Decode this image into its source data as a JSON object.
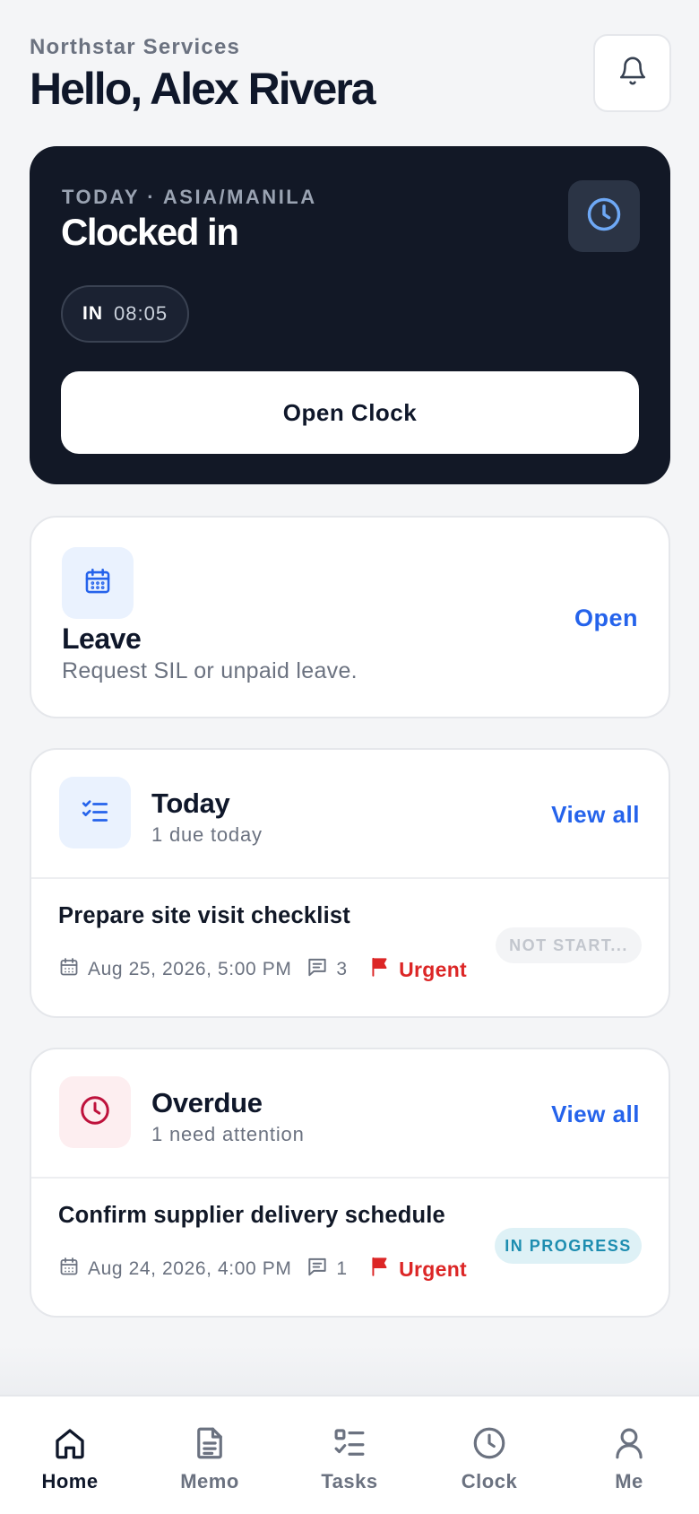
{
  "header": {
    "org_name": "Northstar Services",
    "greeting": "Hello, Alex Rivera",
    "bell_icon": "bell-icon"
  },
  "clock": {
    "label": "TODAY · ASIA/MANILA",
    "status": "Clocked in",
    "icon": "clock-icon",
    "in_label": "IN",
    "in_time": "08:05",
    "button_label": "Open Clock"
  },
  "leave": {
    "icon": "calendar-icon",
    "title": "Leave",
    "subtitle": "Request SIL or unpaid leave.",
    "link_label": "Open"
  },
  "today": {
    "icon": "checklist-icon",
    "title": "Today",
    "subtitle": "1 due today",
    "link_label": "View all",
    "task": {
      "title": "Prepare site visit checklist",
      "due": "Aug 25, 2026, 5:00 PM",
      "comments": "3",
      "priority": "Urgent",
      "status": "NOT START..."
    }
  },
  "overdue": {
    "icon": "clock-icon",
    "title": "Overdue",
    "subtitle": "1 need attention",
    "link_label": "View all",
    "task": {
      "title": "Confirm supplier delivery schedule",
      "due": "Aug 24, 2026, 4:00 PM",
      "comments": "1",
      "priority": "Urgent",
      "status": "IN PROGRESS"
    }
  },
  "nav": {
    "items": [
      {
        "label": "Home",
        "icon": "home-icon",
        "active": true
      },
      {
        "label": "Memo",
        "icon": "document-icon",
        "active": false
      },
      {
        "label": "Tasks",
        "icon": "tasks-icon",
        "active": false
      },
      {
        "label": "Clock",
        "icon": "clock-icon",
        "active": false
      },
      {
        "label": "Me",
        "icon": "user-icon",
        "active": false
      }
    ]
  },
  "colors": {
    "accent": "#2563eb",
    "dark_card": "#121826",
    "urgent": "#dc2626",
    "in_progress": "#1d8db0",
    "background": "#f4f5f7"
  }
}
